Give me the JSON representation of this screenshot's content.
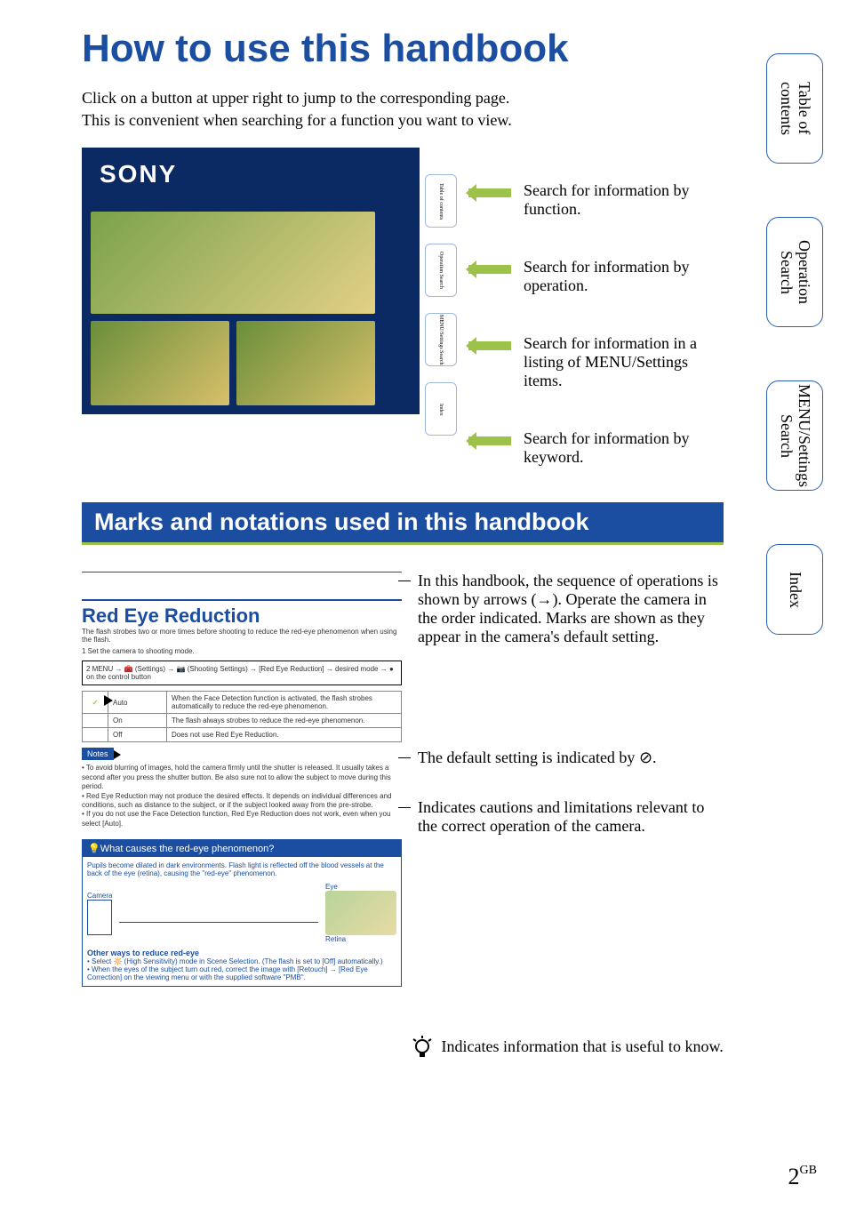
{
  "title": "How to use this handbook",
  "intro_line1": "Click on a button at upper right to jump to the corresponding page.",
  "intro_line2": "This is convenient when searching for a function you want to view.",
  "sony_logo": "SONY",
  "mini_tabs": {
    "t1": "Table of contents",
    "t2": "Operation Search",
    "t3": "MENU/Settings Search",
    "t4": "Index"
  },
  "arrow_descs": {
    "a1": "Search for information by function.",
    "a2": "Search for information by operation.",
    "a3": "Search for information in a listing of MENU/Settings items.",
    "a4": "Search for information by keyword."
  },
  "section_heading": "Marks and notations used in this handbook",
  "sample": {
    "title": "Red Eye Reduction",
    "lede": "The flash strobes two or more times before shooting to reduce the red-eye phenomenon when using the flash.",
    "step1": "1  Set the camera to shooting mode.",
    "step2": "2  MENU → 🧰 (Settings) → 📷 (Shooting Settings) → [Red Eye Reduction] → desired mode → ● on the control button",
    "table": {
      "r1a": "Auto",
      "r1b": "When the Face Detection function is activated, the flash strobes automatically to reduce the red-eye phenomenon.",
      "r2a": "On",
      "r2b": "The flash always strobes to reduce the red-eye phenomenon.",
      "r3a": "Off",
      "r3b": "Does not use Red Eye Reduction."
    },
    "notes_label": "Notes",
    "notes_items": "• To avoid blurring of images, hold the camera firmly until the shutter is released. It usually takes a second after you press the shutter button. Be also sure not to allow the subject to move during this period.\n• Red Eye Reduction may not produce the desired effects. It depends on individual differences and conditions, such as distance to the subject, or if the subject looked away from the pre-strobe.\n• If you do not use the Face Detection function, Red Eye Reduction does not work, even when you select [Auto].",
    "tip_head": "What causes the red-eye phenomenon?",
    "tip_body": "Pupils become dilated in dark environments. Flash light is reflected off the blood vessels at the back of the eye (retina), causing the \"red-eye\" phenomenon.",
    "tip_cam": "Camera",
    "tip_eye": "Eye",
    "tip_retina": "Retina",
    "other_title": "Other ways to reduce red-eye",
    "other_items": "• Select 🔆 (High Sensitivity) mode in Scene Selection. (The flash is set to [Off] automatically.)\n• When the eyes of the subject turn out red, correct the image with [Retouch] → [Red Eye Correction] on the viewing menu or with the supplied software \"PMB\"."
  },
  "callouts": {
    "c1": "In this handbook, the sequence of operations is shown by arrows (→). Operate the camera in the order indicated. Marks are shown as they appear in the camera's default setting.",
    "c2_pre": "The default setting is indicated by ",
    "c2_post": ".",
    "c3": "Indicates cautions and limitations relevant to the correct operation of the camera.",
    "c4": " Indicates information that is useful to know."
  },
  "side_tabs": {
    "t1": "Table of\ncontents",
    "t2": "Operation\nSearch",
    "t3": "MENU/Settings\nSearch",
    "t4": "Index"
  },
  "page_number": "2",
  "page_suffix": "GB",
  "check_glyph": "✓",
  "no_glyph": "⊘"
}
